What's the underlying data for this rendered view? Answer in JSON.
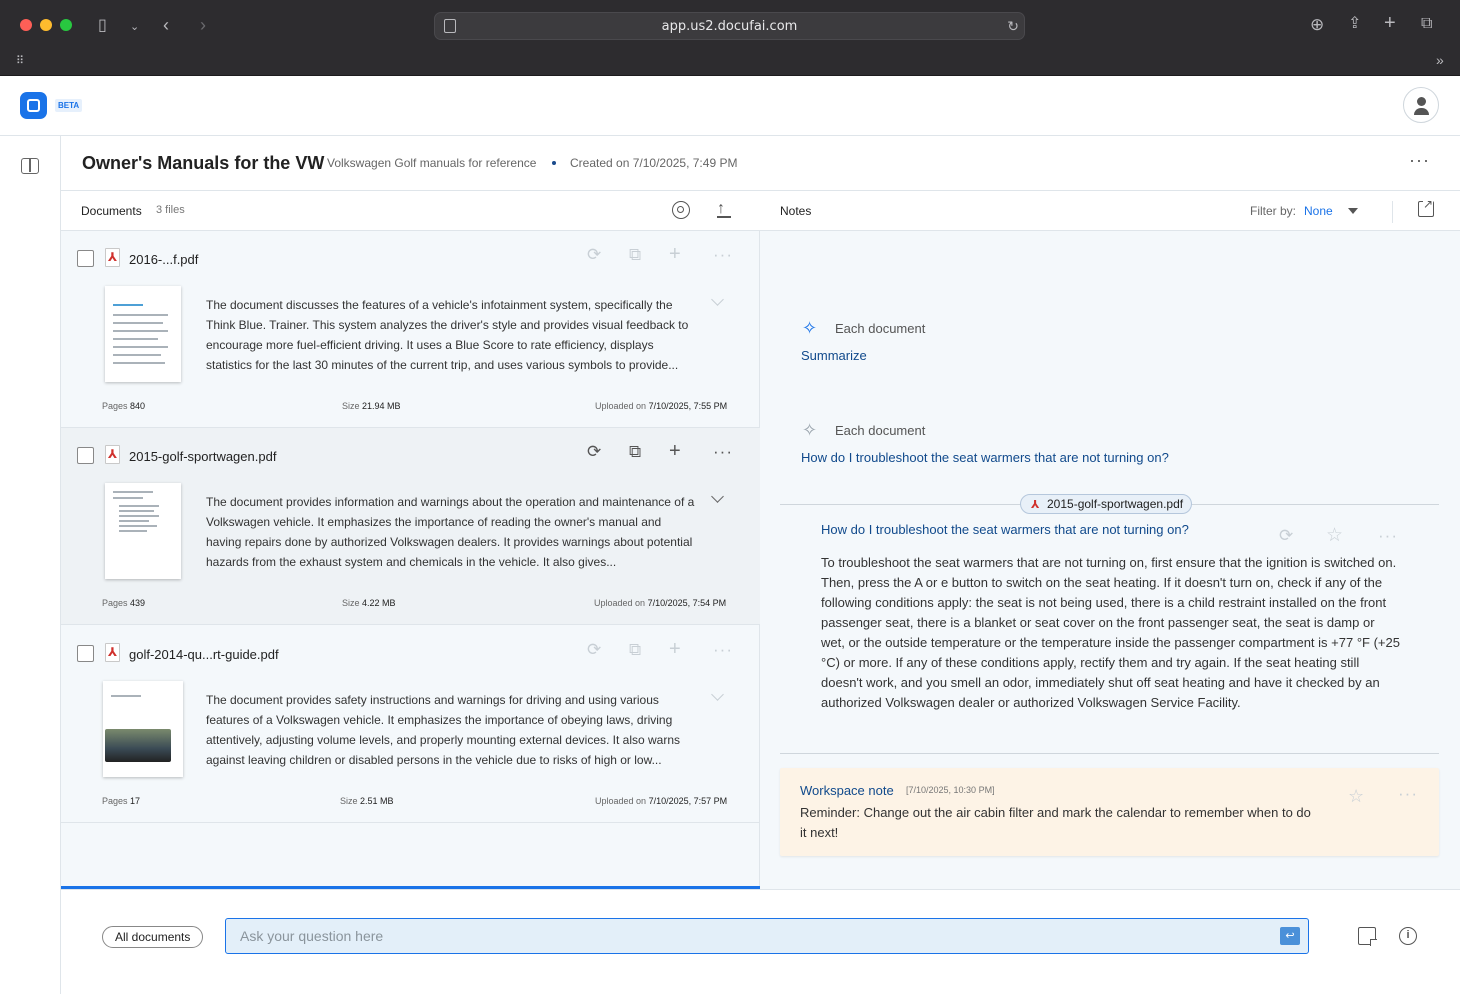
{
  "browser": {
    "url": "app.us2.docufai.com"
  },
  "app": {
    "beta_badge": "BETA"
  },
  "workspace": {
    "title": "Owner's Manuals for the VW",
    "description": "Volkswagen Golf manuals for reference",
    "created": "Created on 7/10/2025, 7:49 PM",
    "more": "···"
  },
  "documents": {
    "header": "Documents",
    "count": "3 files",
    "items": [
      {
        "name": "2016-...f.pdf",
        "summary": "The document discusses the features of a vehicle's infotainment system, specifically the Think Blue. Trainer. This system analyzes the driver's style and provides visual feedback to encourage more fuel-efficient driving. It uses a Blue Score to rate efficiency, displays statistics for the last 30 minutes of the current trip, and uses various symbols to provide...",
        "pages_label": "Pages",
        "pages": "840",
        "size_label": "Size",
        "size": "21.94 MB",
        "uploaded_label": "Uploaded on",
        "uploaded": "7/10/2025, 7:55 PM"
      },
      {
        "name": "2015-golf-sportwagen.pdf",
        "summary": "The document provides information and warnings about the operation and maintenance of a Volkswagen vehicle. It emphasizes the importance of reading the owner's manual and having repairs done by authorized Volkswagen dealers. It provides warnings about potential hazards from the exhaust system and chemicals in the vehicle. It also gives...",
        "pages_label": "Pages",
        "pages": "439",
        "size_label": "Size",
        "size": "4.22 MB",
        "uploaded_label": "Uploaded on",
        "uploaded": "7/10/2025, 7:54 PM"
      },
      {
        "name": "golf-2014-qu...rt-guide.pdf",
        "summary": "The document provides safety instructions and warnings for driving and using various features of a Volkswagen vehicle. It emphasizes the importance of obeying laws, driving attentively, adjusting volume levels, and properly mounting external devices. It also warns against leaving children or disabled persons in the vehicle due to risks of high or low...",
        "pages_label": "Pages",
        "pages": "17",
        "size_label": "Size",
        "size": "2.51 MB",
        "uploaded_label": "Uploaded on",
        "uploaded": "7/10/2025, 7:57 PM"
      }
    ]
  },
  "notes": {
    "header": "Notes",
    "filter_label": "Filter by:",
    "filter_value": "None",
    "prompts": [
      {
        "scope": "Each document",
        "text": "Summarize"
      },
      {
        "scope": "Each document",
        "text": "How do I troubleshoot the seat warmers that are not turning on?"
      }
    ],
    "answer": {
      "source": "2015-golf-sportwagen.pdf",
      "question": "How do I troubleshoot the seat warmers that are not turning on?",
      "text": "To troubleshoot the seat warmers that are not turning on, first ensure that the ignition is switched on. Then, press the A or e button to switch on the seat heating. If it doesn't turn on, check if any of the following conditions apply: the seat is not being used, there is a child restraint installed on the front passenger seat, there is a blanket or seat cover on the front passenger seat, the seat is damp or wet, or the outside temperature or the temperature inside the passenger compartment is +77 °F (+25 °C) or more. If any of these conditions apply, rectify them and try again. If the seat heating still doesn't work, and you smell an odor, immediately shut off seat heating and have it checked by an authorized Volkswagen dealer or authorized Volkswagen Service Facility."
    },
    "workspace_note": {
      "label": "Workspace note",
      "timestamp": "[7/10/2025, 10:30 PM]",
      "text": "Reminder: Change out the air cabin filter and mark the calendar to remember when to do it next!"
    }
  },
  "bottom": {
    "scope_button": "All documents",
    "ask_placeholder": "Ask your question here",
    "send_symbol": "↩"
  },
  "colors": {
    "accent": "#1a73e8",
    "link": "#114a8c",
    "note_bg": "#fdf3e6"
  }
}
